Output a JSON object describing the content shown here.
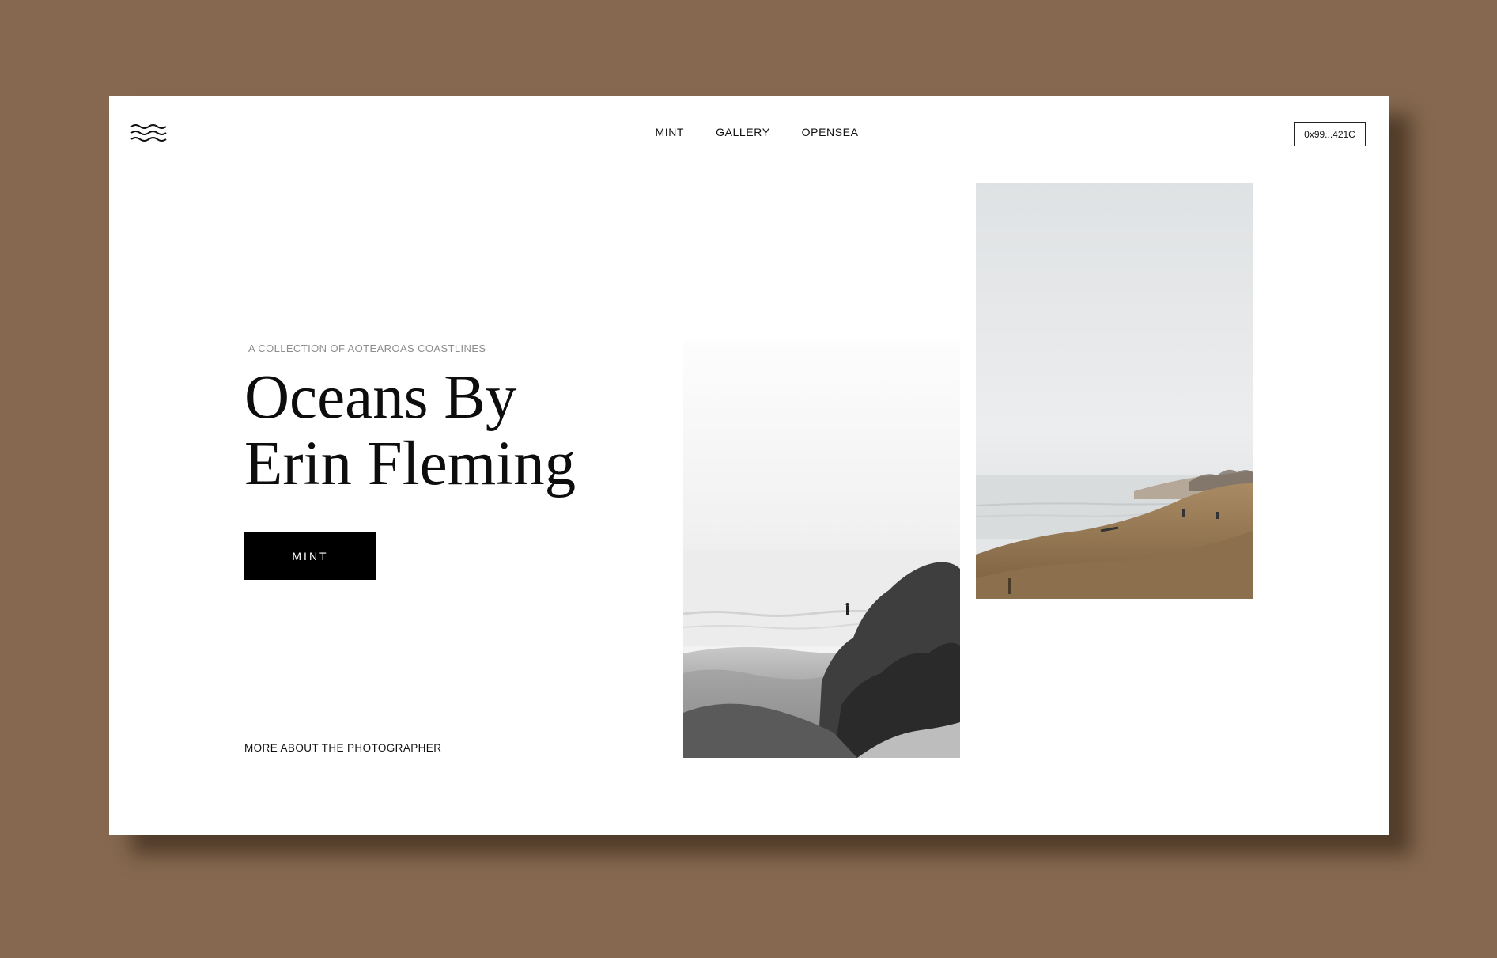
{
  "header": {
    "logo_icon": "waves-icon",
    "nav": [
      {
        "label": "MINT"
      },
      {
        "label": "GALLERY"
      },
      {
        "label": "OPENSEA"
      }
    ],
    "wallet_address": "0x99...421C"
  },
  "hero": {
    "eyebrow": "A COLLECTION OF AOTEAROAS COASTLINES",
    "title_line1": "Oceans By",
    "title_line2": "Erin Fleming",
    "cta_label": "MINT",
    "about_link": "MORE ABOUT THE PHOTOGRAPHER"
  },
  "gallery": {
    "photos": [
      {
        "name": "black-and-white-coast-photo",
        "tone": "monochrome"
      },
      {
        "name": "misty-beach-dunes-photo",
        "tone": "warm"
      }
    ]
  },
  "colors": {
    "backdrop": "#85684f",
    "page": "#ffffff",
    "cta_background": "#000000",
    "eyebrow_text": "#8d8d8d"
  }
}
